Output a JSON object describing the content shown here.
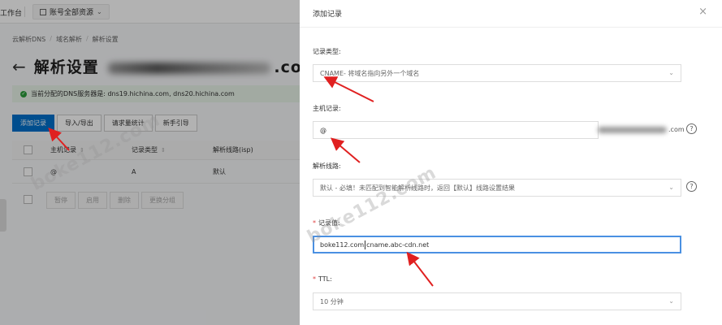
{
  "background": {
    "topbar": {
      "workspace": "工作台",
      "account_label": "账号全部资源"
    },
    "breadcrumb": [
      "云解析DNS",
      "域名解析",
      "解析设置"
    ],
    "title": {
      "prefix": "解析设置",
      "domain_suffix": ".com"
    },
    "notice": "当前分配的DNS服务器是: dns19.hichina.com, dns20.hichina.com",
    "buttons": {
      "add": "添加记录",
      "import": "导入/导出",
      "stats": "请求量统计",
      "guide": "新手引导"
    },
    "table": {
      "headers": [
        "主机记录",
        "记录类型",
        "解析线路(isp)"
      ],
      "rows": [
        {
          "host": "@",
          "type": "A",
          "line": "默认"
        }
      ]
    },
    "bulk_buttons": [
      "暂停",
      "启用",
      "删除",
      "更换分组"
    ]
  },
  "drawer": {
    "title": "添加记录",
    "close_icon": "×",
    "record_type": {
      "label": "记录类型:",
      "value": "CNAME- 将域名指向另外一个域名"
    },
    "host": {
      "label": "主机记录:",
      "value": "@",
      "suffix": ".com"
    },
    "line": {
      "label": "解析线路:",
      "value": "默认 - 必填！未匹配到智能解析线路时，返回【默认】线路设置结果"
    },
    "record_value": {
      "label": "记录值:",
      "value_a": "boke112.com",
      "value_b": "cname.abc-cdn.net"
    },
    "ttl": {
      "label": "TTL:",
      "value": "10 分钟"
    }
  },
  "watermark": "boke112.com"
}
